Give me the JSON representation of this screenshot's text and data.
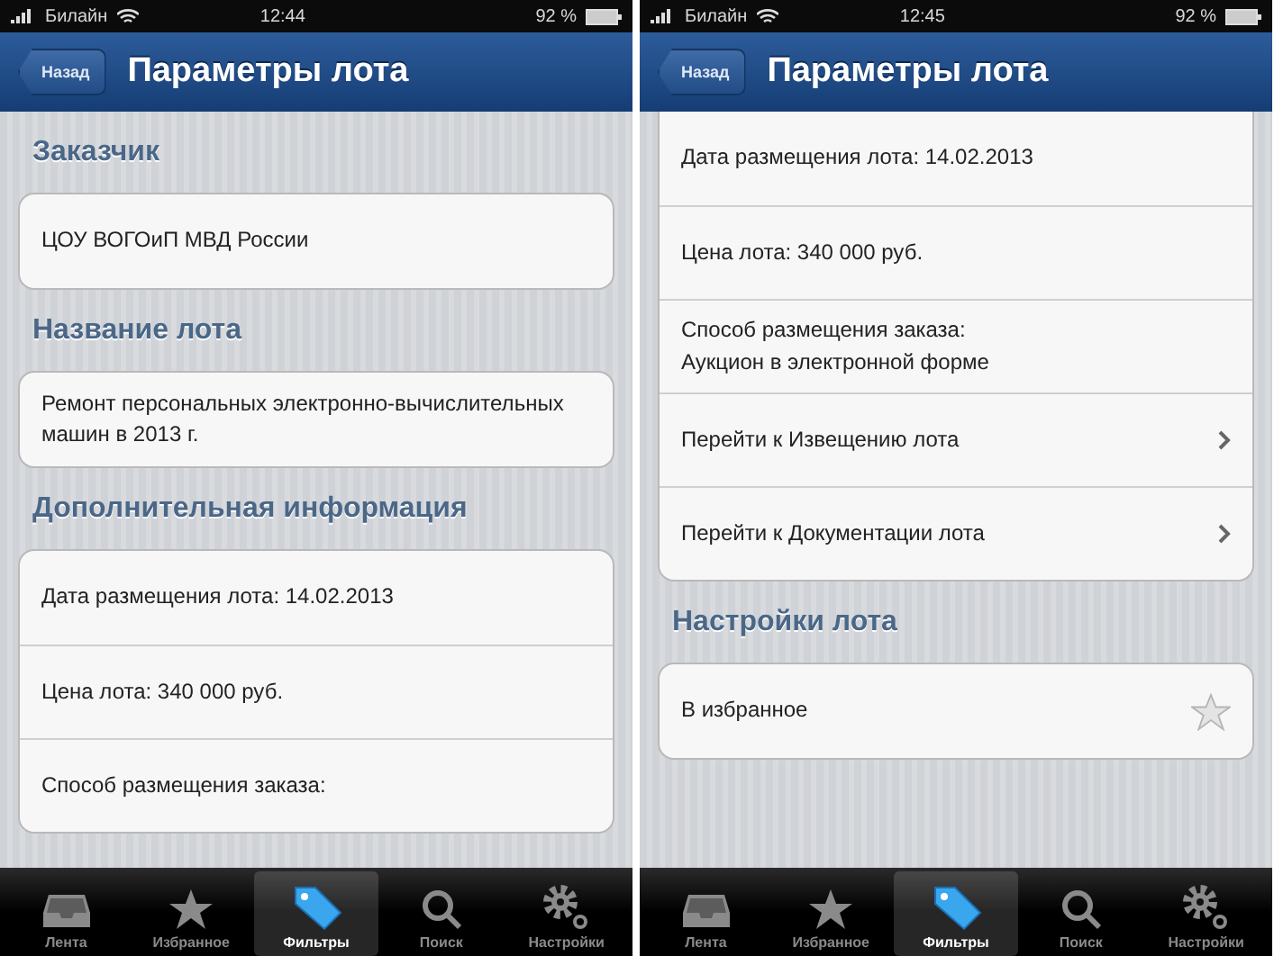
{
  "screens": [
    {
      "status_bar": {
        "carrier": "Билайн",
        "time": "12:44",
        "battery": "92 %"
      },
      "nav_bar": {
        "back": "Назад",
        "title": "Параметры лота"
      },
      "sections": [
        {
          "header": "Заказчик",
          "rows": [
            {
              "kind": "text",
              "text": "ЦОУ ВОГОиП МВД России"
            }
          ]
        },
        {
          "header": "Название лота",
          "rows": [
            {
              "kind": "text",
              "text": "Ремонт персональных электронно-вычислительных машин в 2013 г."
            }
          ]
        },
        {
          "header": "Дополнительная информация",
          "rows": [
            {
              "kind": "text",
              "text": "Дата размещения лота: 14.02.2013"
            },
            {
              "kind": "text",
              "text": "Цена лота: 340 000 руб."
            },
            {
              "kind": "text",
              "text": "Способ размещения заказа:"
            }
          ]
        }
      ],
      "tabs": [
        {
          "label": "Лента",
          "selected": false
        },
        {
          "label": "Избранное",
          "selected": false
        },
        {
          "label": "Фильтры",
          "selected": true
        },
        {
          "label": "Поиск",
          "selected": false
        },
        {
          "label": "Настройки",
          "selected": false
        }
      ]
    },
    {
      "status_bar": {
        "carrier": "Билайн",
        "time": "12:45",
        "battery": "92 %"
      },
      "nav_bar": {
        "back": "Назад",
        "title": "Параметры лота"
      },
      "sections": [
        {
          "rows": [
            {
              "kind": "text",
              "text": "Дата размещения лота: 14.02.2013"
            },
            {
              "kind": "text",
              "text": "Цена лота: 340 000 руб."
            },
            {
              "kind": "text",
              "text": "Способ размещения заказа:\nАукцион в электронной форме"
            },
            {
              "kind": "link",
              "text": "Перейти к Извещению лота"
            },
            {
              "kind": "link",
              "text": "Перейти к Документации лота"
            }
          ]
        },
        {
          "header": "Настройки лота",
          "rows": [
            {
              "kind": "favorite",
              "text": "В избранное",
              "on": false
            }
          ]
        }
      ],
      "tabs": [
        {
          "label": "Лента",
          "selected": false
        },
        {
          "label": "Избранное",
          "selected": false
        },
        {
          "label": "Фильтры",
          "selected": true
        },
        {
          "label": "Поиск",
          "selected": false
        },
        {
          "label": "Настройки",
          "selected": false
        }
      ]
    }
  ]
}
